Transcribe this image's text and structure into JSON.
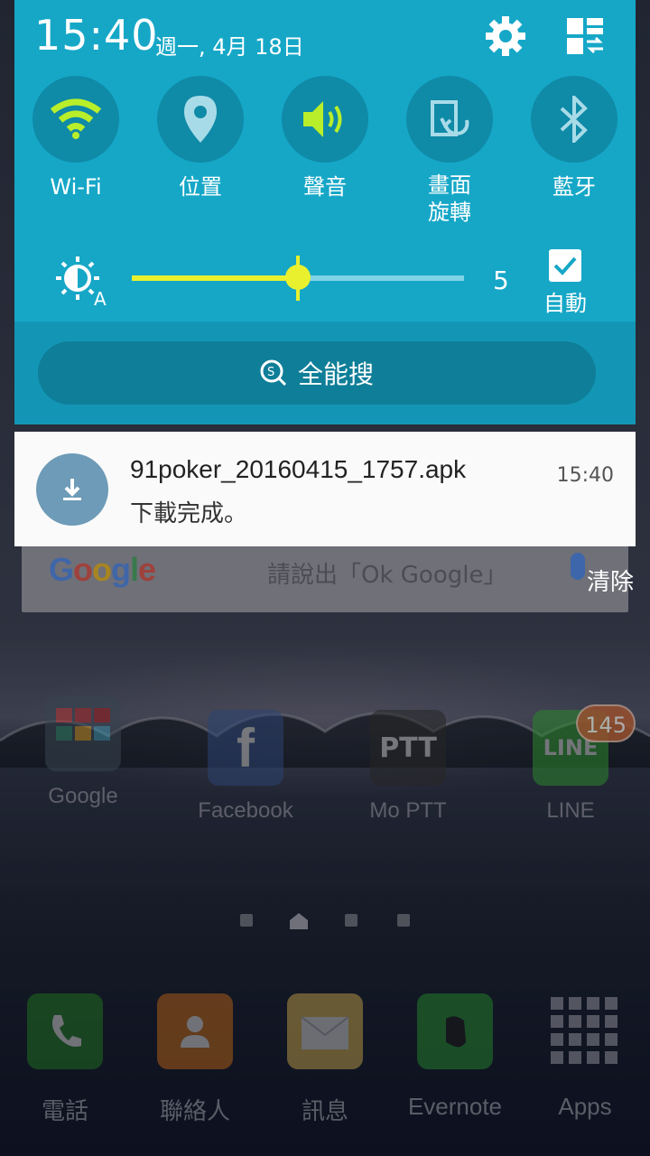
{
  "status": {
    "time": "15:40",
    "date": "週一, 4月 18日"
  },
  "quick_settings": [
    {
      "id": "wifi",
      "label": "Wi-Fi",
      "icon": "wifi-icon",
      "active": true
    },
    {
      "id": "location",
      "label": "位置",
      "icon": "location-icon",
      "active": false
    },
    {
      "id": "sound",
      "label": "聲音",
      "icon": "sound-icon",
      "active": true
    },
    {
      "id": "rotation",
      "label": "畫面\n旋轉",
      "icon": "screen-rotation-icon",
      "active": false
    },
    {
      "id": "bluetooth",
      "label": "藍牙",
      "icon": "bluetooth-icon",
      "active": false
    }
  ],
  "brightness": {
    "value": "5",
    "level": 0.5,
    "auto_label": "自動",
    "auto_checked": true
  },
  "finder": {
    "label": "全能搜"
  },
  "notification": {
    "title": "91poker_20160415_1757.apk",
    "text": "下載完成。",
    "time": "15:40"
  },
  "clear_label": "清除",
  "google_bar": {
    "logo": "Google",
    "hint": "請說出「Ok Google」"
  },
  "apps": [
    {
      "label": "Google"
    },
    {
      "label": "Facebook"
    },
    {
      "label": "Mo PTT"
    },
    {
      "label": "LINE",
      "badge": "145"
    }
  ],
  "dock": [
    {
      "label": "電話"
    },
    {
      "label": "聯絡人"
    },
    {
      "label": "訊息"
    },
    {
      "label": "Evernote"
    },
    {
      "label": "Apps"
    }
  ],
  "colors": {
    "shade": "#16a7c7",
    "toggle_circle": "#0f8aa7",
    "active_accent": "#b9ee2a",
    "slider": "#e9f02d"
  }
}
